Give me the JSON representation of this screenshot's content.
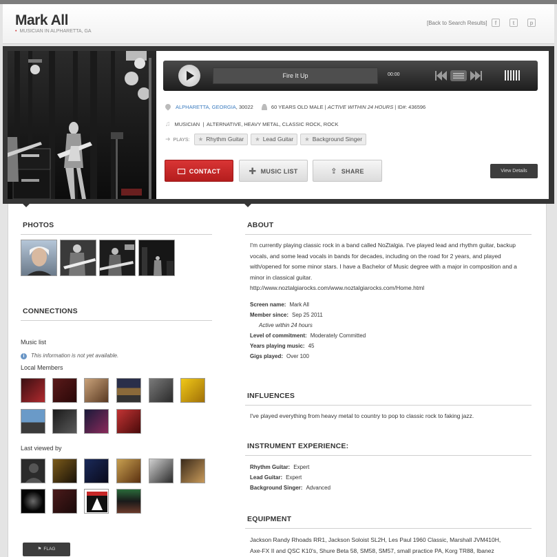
{
  "header": {
    "name": "Mark All",
    "subtitle": "MUSICIAN IN ALPHARETTA, GA",
    "back_link": "[Back to Search Results]",
    "social": [
      "facebook-icon",
      "twitter-icon",
      "pinterest-icon"
    ]
  },
  "player": {
    "track": "Fire It Up",
    "time": "00:00"
  },
  "meta": {
    "location_link": "ALPHARETTA, GEORGIA",
    "zip": ", 30022",
    "age_gender": "60 YEARS OLD MALE",
    "activity": "ACTIVE WITHIN 24 HOURS",
    "id": "ID#: 436596",
    "role": "MUSICIAN",
    "genres": "ALTERNATIVE, HEAVY METAL, CLASSIC ROCK, ROCK",
    "plays_label": "PLAYS:",
    "plays": [
      "Rhythm Guitar",
      "Lead Guitar",
      "Background Singer"
    ]
  },
  "actions": {
    "contact": "CONTACT",
    "music_list": "MUSIC LIST",
    "share": "SHARE",
    "view_details": "View Details"
  },
  "photos": {
    "title": "PHOTOS"
  },
  "connections": {
    "title": "CONNECTIONS",
    "music_list_label": "Music list",
    "music_list_note": "This information is not yet available.",
    "local_members_label": "Local Members",
    "last_viewed_label": "Last viewed by"
  },
  "about": {
    "title": "ABOUT",
    "text": "I'm currently playing classic rock in a band called NoZtalgia. I've played lead and rhythm guitar, backup vocals, and some lead vocals in bands for decades, including on the road for 2 years, and played with/opened for some minor stars. I have a Bachelor of Music degree with a major in composition and a minor in classical guitar.",
    "url": "http://www.noztalgiarocks.com/www.noztalgiarocks.com/Home.html",
    "screen_name_label": "Screen name:",
    "screen_name": "Mark All",
    "member_since_label": "Member since:",
    "member_since": "Sep 25 2011",
    "active_note": "Active within 24 hours",
    "commitment_label": "Level of commitment:",
    "commitment": "Moderately Committed",
    "years_label": "Years playing music:",
    "years": "45",
    "gigs_label": "Gigs played:",
    "gigs": "Over 100"
  },
  "influences": {
    "title": "INFLUENCES",
    "text": "I've played everything from heavy metal to country to pop to classic rock to faking jazz."
  },
  "instrument_experience": {
    "title": "INSTRUMENT EXPERIENCE:",
    "items": [
      {
        "label": "Rhythm Guitar:",
        "value": "Expert"
      },
      {
        "label": "Lead Guitar:",
        "value": "Expert"
      },
      {
        "label": "Background Singer:",
        "value": "Advanced"
      }
    ]
  },
  "equipment": {
    "title": "EQUIPMENT",
    "line1": "Jackson Randy Rhoads RR1, Jackson Soloist SL2H, Les Paul 1960 Classic, Marshall JVM410H,",
    "line2": "Axe-FX II and QSC K10's, Shure Beta 58, SM58, SM57, small practice PA, Korg TR88, Ibanez"
  },
  "flag": {
    "label": "FLAG"
  },
  "colors": {
    "accent_red": "#c62828",
    "link_blue": "#3a7bbf",
    "dark_strip": "#353535"
  }
}
